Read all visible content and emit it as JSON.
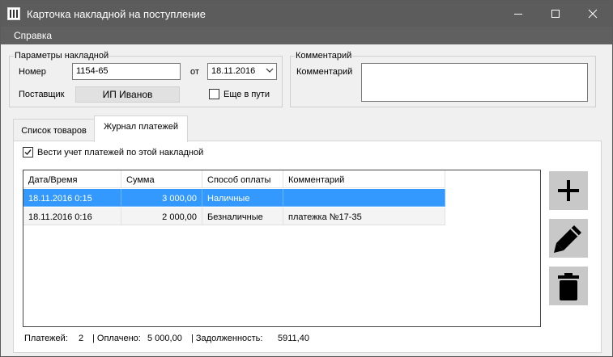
{
  "window": {
    "title": "Карточка накладной на поступление",
    "app_icon": "app-icon",
    "controls": [
      "minimize-icon",
      "maximize-icon",
      "close-icon"
    ]
  },
  "menu": {
    "items": [
      "Справка"
    ]
  },
  "params": {
    "legend": "Параметры накладной",
    "number_label": "Номер",
    "number_value": "1154-65",
    "date_label": "от",
    "date_value": "18.11.2016",
    "supplier_label": "Поставщик",
    "supplier_value": "ИП Иванов",
    "in_transit_label": "Еще в пути",
    "in_transit_checked": false
  },
  "comment": {
    "legend": "Комментарий",
    "label": "Комментарий",
    "value": ""
  },
  "tabs": [
    {
      "label": "Список товаров",
      "active": false
    },
    {
      "label": "Журнал платежей",
      "active": true
    }
  ],
  "payments": {
    "track_label": "Вести учет платежей по этой накладной",
    "track_checked": true,
    "columns": [
      "Дата/Время",
      "Сумма",
      "Способ оплаты",
      "Комментарий"
    ],
    "rows": [
      {
        "datetime": "18.11.2016 0:15",
        "amount": "3 000,00",
        "method": "Наличные",
        "comment": "",
        "selected": true
      },
      {
        "datetime": "18.11.2016 0:16",
        "amount": "2 000,00",
        "method": "Безналичные",
        "comment": "платежка №17-35",
        "selected": false
      }
    ],
    "actions": [
      "add-icon",
      "edit-icon",
      "delete-icon"
    ]
  },
  "status": {
    "payments_label": "Платежей:",
    "payments_count": "2",
    "paid_label": "| Оплачено:",
    "paid_value": "5 000,00",
    "debt_label": "| Задолженность:",
    "debt_value": "5911,40"
  },
  "colors": {
    "titlebar": "#5c5c5c",
    "menubar": "#606060",
    "selection": "#3399ff",
    "action_button": "#c8c8c8"
  }
}
